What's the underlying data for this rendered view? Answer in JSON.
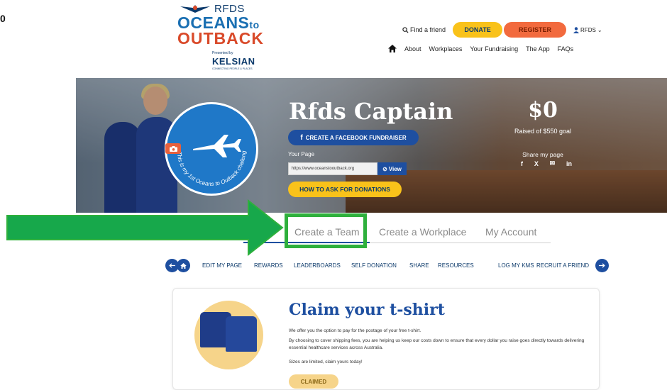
{
  "step_number": "0",
  "logo": {
    "rfds": "RFDS",
    "oceans": "OCEANS",
    "to": "to",
    "outback": "OUTBACK",
    "presented_by": "Presented by",
    "sponsor": "KELSIAN",
    "sponsor_tagline": "CONNECTING PEOPLE & PLACES"
  },
  "header": {
    "find_friend": "Find a friend",
    "donate": "DONATE",
    "register": "REGISTER",
    "user": "RFDS"
  },
  "nav": {
    "items": [
      "About",
      "Workplaces",
      "Your Fundraising",
      "The App",
      "FAQs"
    ]
  },
  "hero": {
    "name": "Rfds Captain",
    "facebook_button": "CREATE A FACEBOOK FUNDRAISER",
    "your_page_label": "Your Page",
    "page_url": "https://www.oceanstooutback.org",
    "view_button": "View",
    "howto_button": "HOW TO ASK FOR DONATIONS",
    "badge_text": "This is my 1st Oceans to Outback challenge",
    "raised_amount": "$0",
    "raised_goal": "Raised of $550 goal",
    "share_label": "Share my page",
    "share_icons": [
      "f",
      "X",
      "✉",
      "in"
    ]
  },
  "tabs": [
    "Create a Team",
    "Create a Workplace",
    "My Account"
  ],
  "subnav": [
    "EDIT MY PAGE",
    "REWARDS",
    "LEADERBOARDS",
    "SELF DONATION",
    "SHARE",
    "RESOURCES",
    "LOG MY KMS",
    "RECRUIT A FRIEND"
  ],
  "card": {
    "title": "Claim your t-shirt",
    "p1": "We offer you the option to pay for the postage of your free t-shirt.",
    "p2": "By choosing to cover shipping fees, you are helping us keep our costs down to ensure that every dollar you raise goes directly towards delivering essential healthcare services across Australia.",
    "p3": "Sizes are limited, claim yours today!",
    "button": "CLAIMED"
  },
  "colors": {
    "brand_blue": "#1e4fa0",
    "donate_yellow": "#f9c21a",
    "register_orange": "#f26a3e",
    "highlight_green": "#2eb03c"
  }
}
